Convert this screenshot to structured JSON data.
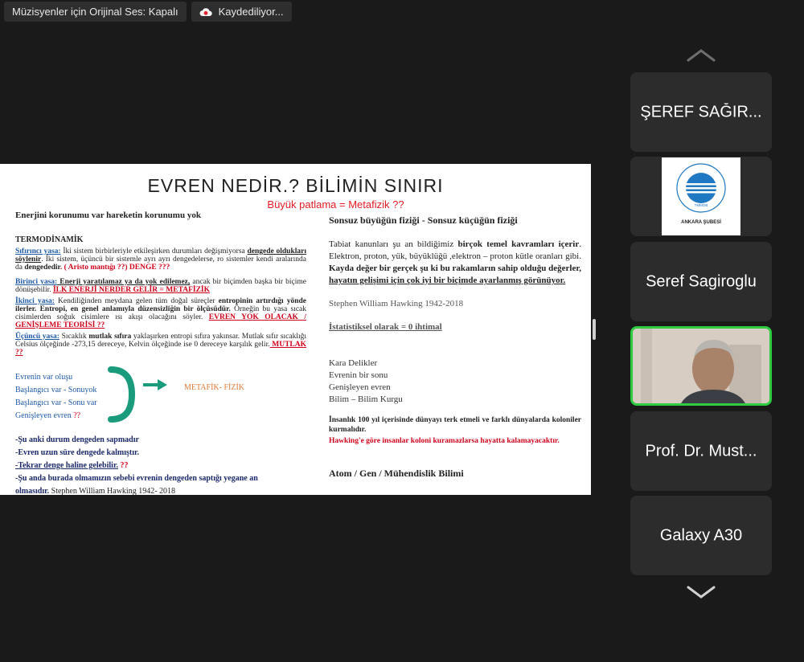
{
  "topbar": {
    "original_sound": "Müzisyenler için Orijinal Ses: Kapalı",
    "recording": "Kaydediliyor..."
  },
  "slide": {
    "title": "EVREN NEDİR.? BİLİMİN SINIRI",
    "subtitle": "Büyük patlama = Metafizik ??",
    "left": {
      "heading": "Enerjini korunumu var hareketin korunumu yok",
      "termo": "TERMODİNAMİK",
      "zeroth_label": "Sıfırıncı yasa:",
      "zeroth_text": " İki sistem birbirleriyle etkileşirken durumları değişmiyorsa ",
      "zeroth_u": "dengede oldukları söylenir",
      "zeroth_text2": ". İki sistem, üçüncü bir sistemle ayrı ayrı dengedelerse, ro sistemler kendi aralarında da ",
      "zeroth_b": "dengededir",
      "zeroth_red": ". ( Aristo mantığı ??) DENGE ???",
      "first_label": "Birinci yasa:",
      "first_text": " Enerji yaratılamaz ya da yok edilemez,",
      "first_text2": " ancak bir biçimden başka bir biçime dönüşebilir. ",
      "first_red": "İLK ENERJİ NERDER GELİR = METAFİZİK",
      "second_label": "İkinci yasa:",
      "second_text": " Kendiliğinden meydana gelen tüm doğal süreçler ",
      "second_b": "entropinin artırdığı yönde ilerler. Entropi, en genel anlamıyla düzensizliğin bir ölçüsüdür.",
      "second_text2": " Örneğin bu yasa sıcak cisimlerden soğuk cisimlere ısı akışı olacağını söyler. ",
      "second_red": "EVREN YOK OLACAK / GENİŞLEME TEORİSİ ??",
      "third_label": "Üçüncü yasa:",
      "third_text": " Sıcaklık ",
      "third_b": "mutlak sıfıra",
      "third_text2": " yaklaşırken entropi sıfıra yakınsar. Mutlak sıfır sıcaklığı Celsius ölçeğinde -273,15 dereceye, Kelvin ölçeğinde ise 0 dereceye karşılık gelir.",
      "third_red": " MUTLAK ??",
      "cycle": [
        "Evrenin var oluşu",
        "Başlangıcı var - Sonuyok",
        "Başlangıcı var - Sonu var",
        "Genişleyen evren "
      ],
      "cycle_red": "??",
      "metafizik": "METAFİK- FİZİK",
      "bullets": [
        "-Şu anki durum dengeden sapmadır",
        "-Evren uzun süre dengede kalmıştır.",
        "-Tekrar denge haline gelebilir.",
        "-Şu anda burada olmamızın sebebi evrenin  dengeden saptığı  yegane an olmasıdır."
      ],
      "bullet3_red": " ??",
      "bullet_cite": " Stephen William Hawking 1942- 2018"
    },
    "right": {
      "heading": "Sonsuz büyüğün fiziği - Sonsuz küçüğün fiziği",
      "p1_a": "Tabiat kanunları şu an bildiğimiz ",
      "p1_b": "birçok temel kavramları içerir",
      "p1_c": ". Elektron, proton, yük, büyüklüğü ,elektron – proton kütle oranları  gibi. ",
      "p1_d": "Kayda değer bir gerçek şu ki bu rakamların sahip olduğu değerler, ",
      "p1_e": "hayatın gelişimi için çok iyi bir biçimde ayarlanmış görünüyor.",
      "cite": "Stephen William Hawking 1942-2018",
      "stat": "İstatistiksel olarak = 0 ihtimal",
      "list": [
        "Kara Delikler",
        "Evrenin bir sonu",
        "Genişleyen evren",
        "Bilim – Bilim Kurgu"
      ],
      "p2": "İnsanlık 100 yıl içerisinde dünyayı terk etmeli ve farklı dünyalarda koloniler kurmalıdır.",
      "p3": "Hawking'e göre insanlar koloni kuramazlarsa hayatta kalamayacaktır.",
      "footer": "Atom / Gen / Mühendislik Bilimi"
    }
  },
  "participants": [
    {
      "name": "ŞEREF SAĞIR..."
    },
    {
      "name": "logo",
      "logo_text": "ANKARA ŞUBESİ",
      "logo_ring": "ELEKTRİK MÜHENDİSLERİ ODASI",
      "logo_mid": "TMMOB"
    },
    {
      "name": "Seref Sagiroglu"
    },
    {
      "name": "video"
    },
    {
      "name": "Prof. Dr. Must..."
    },
    {
      "name": "Galaxy A30"
    }
  ],
  "colors": {
    "active_border": "#2ecc40",
    "tile_bg": "#2c2c2c",
    "record_red": "#e0242b"
  }
}
